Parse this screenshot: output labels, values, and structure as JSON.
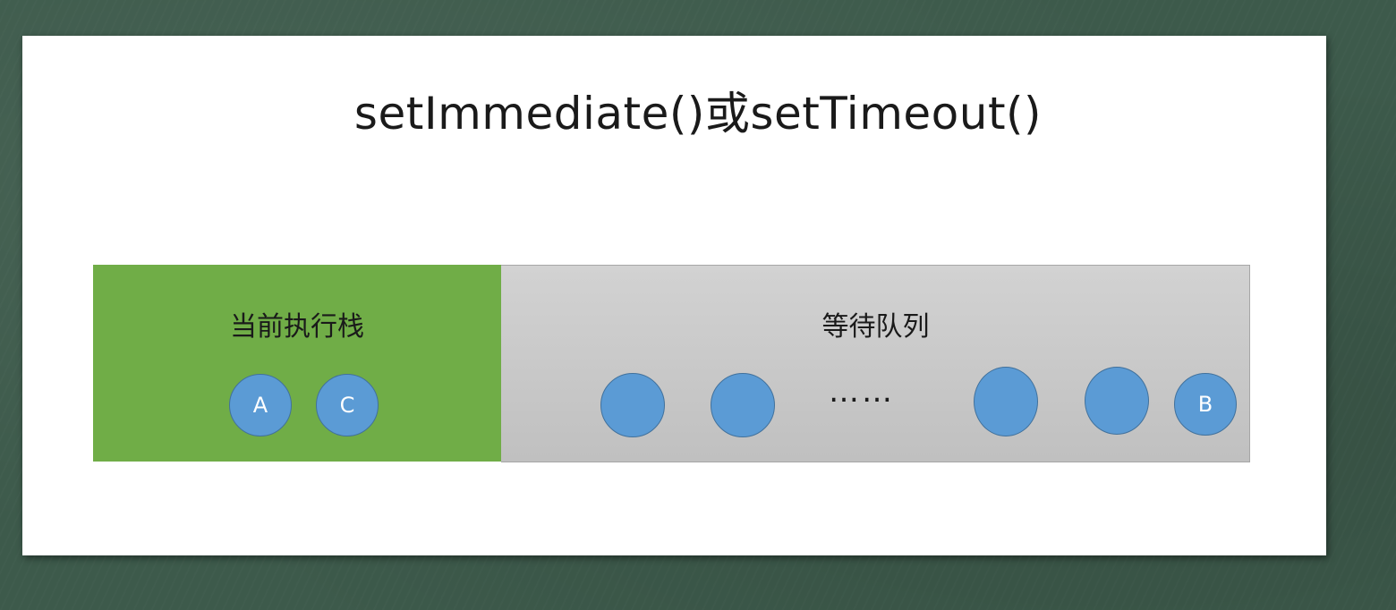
{
  "title": "setImmediate()或setTimeout()",
  "stack": {
    "label": "当前执行栈",
    "tasks": [
      "A",
      "C"
    ]
  },
  "queue": {
    "label": "等待队列",
    "ellipsis": "……",
    "last_task": "B"
  },
  "colors": {
    "stack_bg": "#70ad47",
    "queue_bg": "#c8c8c8",
    "task_fill": "#5b9bd5",
    "task_border": "#41719c",
    "board_bg": "#3d5a4b"
  }
}
